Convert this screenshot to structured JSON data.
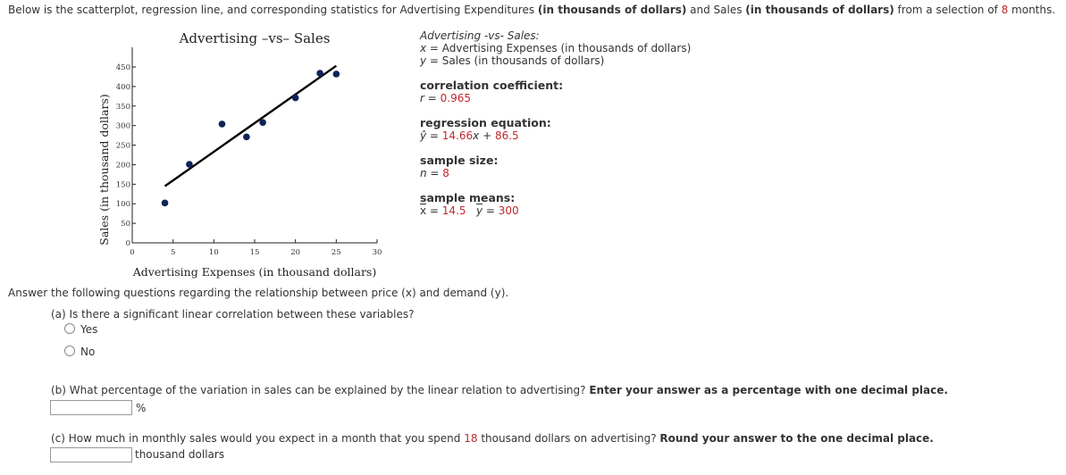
{
  "intro": {
    "p1": "Below is the scatterplot, regression line, and corresponding statistics for Advertising Expenditures ",
    "b1": "(in thousands of dollars)",
    "p2": " and Sales ",
    "b2": "(in thousands of dollars)",
    "p3": " from a selection of ",
    "n": "8",
    "p4": " months."
  },
  "chart_data": {
    "type": "scatter",
    "title": "Advertising –vs– Sales",
    "xlabel": "Advertising Expenses (in thousand dollars)",
    "ylabel": "Sales (in thousand dollars)",
    "xlim": [
      0,
      30
    ],
    "ylim": [
      0,
      450
    ],
    "xticks": [
      0,
      5,
      10,
      15,
      20,
      25,
      30
    ],
    "yticks": [
      0,
      50,
      100,
      150,
      200,
      250,
      300,
      350,
      400,
      450
    ],
    "points": [
      [
        4,
        102
      ],
      [
        7,
        201
      ],
      [
        11,
        304
      ],
      [
        14,
        271
      ],
      [
        16,
        308
      ],
      [
        20,
        371
      ],
      [
        23,
        434
      ],
      [
        25,
        432
      ]
    ],
    "regression_line": {
      "slope": 14.66,
      "intercept": 86.5,
      "x_range": [
        4,
        25
      ]
    },
    "point_color": "#0d2457",
    "line_color": "#000000",
    "grid": false
  },
  "stats": {
    "title": "Advertising -vs- Sales:",
    "x_def_var": "x",
    "x_def": " = Advertising Expenses (in thousands of dollars)",
    "y_def_var": "y",
    "y_def": " = Sales (in thousands of dollars)",
    "corr_label": "correlation coefficient:",
    "r_var": "r",
    "r_value": "0.965",
    "reg_label": "regression equation:",
    "reg_var": "ŷ",
    "reg_slope": "14.66",
    "reg_x": "x",
    "reg_intercept": "86.5",
    "n_label": "sample size:",
    "n_var": "n",
    "n_value": "8",
    "means_label": "sample means:",
    "xbar_var": "x",
    "xbar_value": "14.5",
    "ybar_var": "y",
    "ybar_value": "300"
  },
  "questions": {
    "instruction": "Answer the following questions regarding the relationship between price (x) and demand (y).",
    "a": {
      "text": "(a) Is there a significant linear correlation between these variables?",
      "options": [
        "Yes",
        "No"
      ]
    },
    "b": {
      "text": "(b) What percentage of the variation in sales can be explained by the linear relation to advertising? ",
      "bold": "Enter your answer as a percentage with one decimal place.",
      "value": "",
      "unit": "%"
    },
    "c": {
      "text1": "(c) How much in monthly sales would you expect in a month that you spend ",
      "num": "18",
      "text2": " thousand dollars on advertising? ",
      "bold": "Round your answer to the one decimal place.",
      "value": "",
      "unit": "thousand dollars"
    }
  },
  "colors": {
    "accent_red": "#c0282d",
    "text": "#333333"
  }
}
